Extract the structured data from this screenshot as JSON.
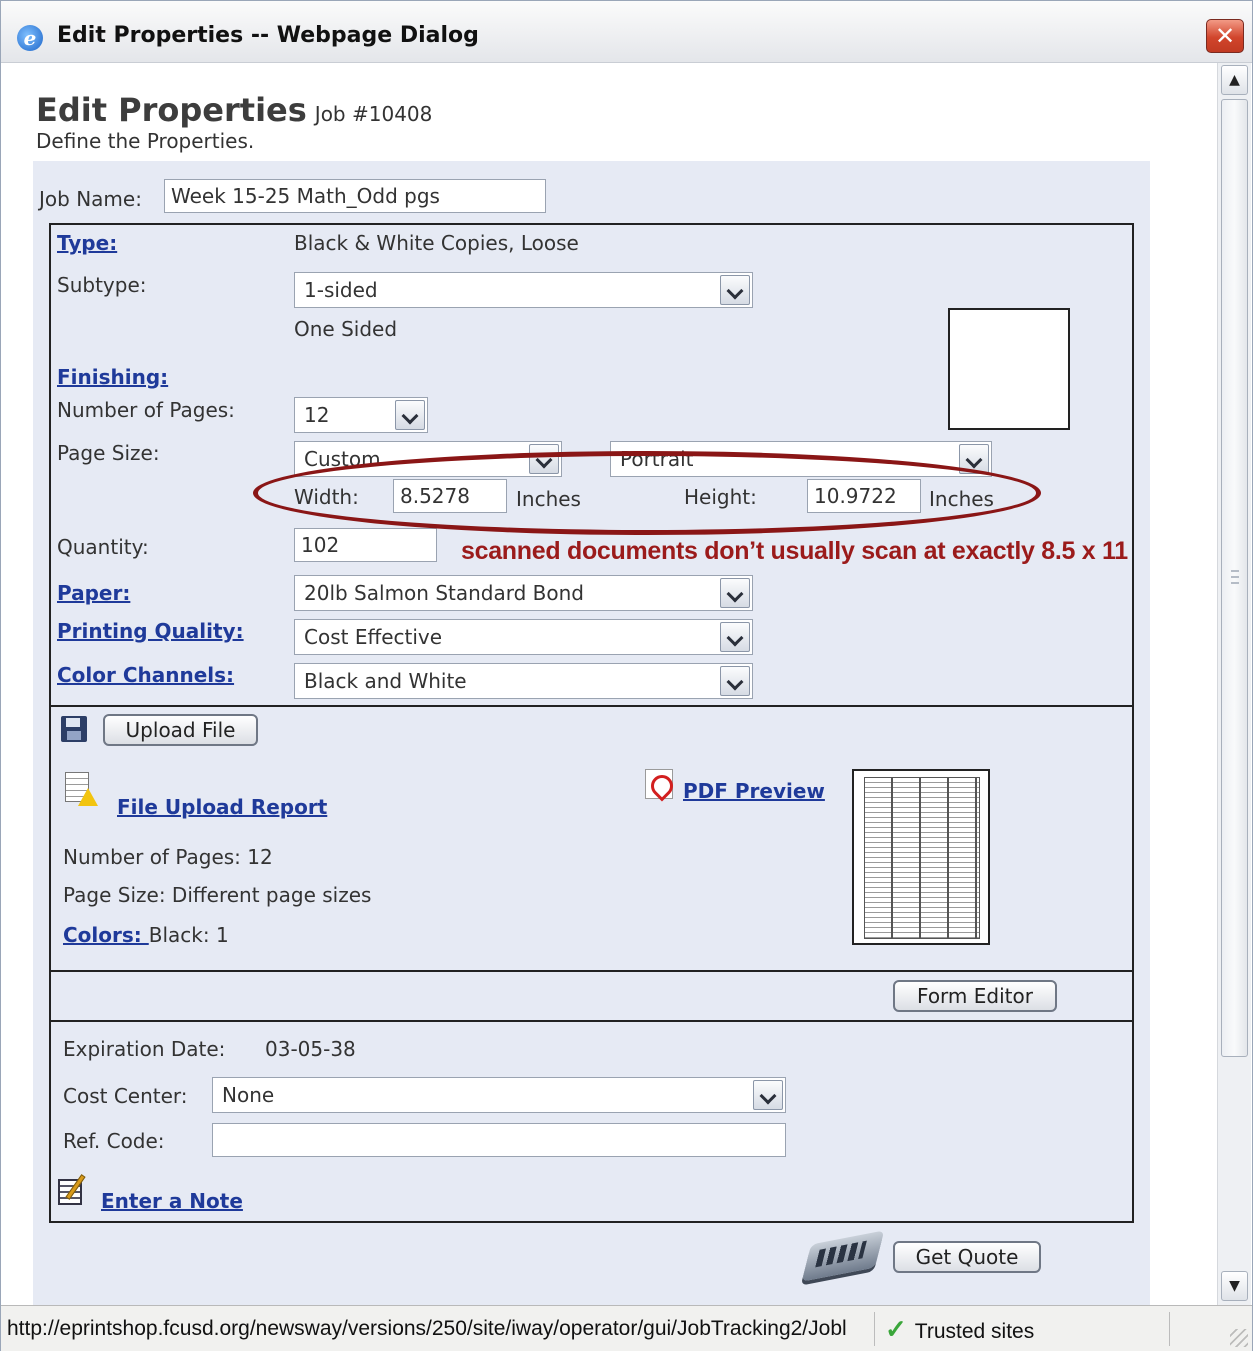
{
  "window": {
    "title": "Edit Properties -- Webpage Dialog",
    "close_symbol": "✕",
    "ie_symbol": "e"
  },
  "header": {
    "title": "Edit Properties",
    "job": "Job #10408",
    "subtitle": "Define the Properties."
  },
  "job_name": {
    "label": "Job Name:",
    "value": "Week 15-25 Math_Odd pgs"
  },
  "type": {
    "label": "Type:",
    "value": "Black & White Copies, Loose"
  },
  "subtype": {
    "label": "Subtype:",
    "value": "1-sided",
    "description": "One Sided"
  },
  "finishing": {
    "label": "Finishing:"
  },
  "pages": {
    "label": "Number of Pages:",
    "value": "12"
  },
  "page_size": {
    "label": "Page Size:",
    "size_value": "Custom",
    "orientation_value": "Portrait",
    "width_label": "Width:",
    "width_value": "8.5278",
    "width_unit": "Inches",
    "height_label": "Height:",
    "height_value": "10.9722",
    "height_unit": "Inches"
  },
  "quantity": {
    "label": "Quantity:",
    "value": "102"
  },
  "annotation": {
    "text": "scanned documents don’t usually scan at exactly 8.5 x 11",
    "color": "#9b1b1b"
  },
  "paper": {
    "label": "Paper:",
    "value": "20lb Salmon Standard Bond"
  },
  "printing_quality": {
    "label": "Printing Quality:",
    "value": "Cost Effective"
  },
  "color_channels": {
    "label": "Color Channels:",
    "value": "Black and White"
  },
  "upload": {
    "button_label": "Upload File",
    "report_link": "File Upload Report",
    "pdf_preview_link": "PDF Preview",
    "pages_text": "Number of Pages: 12",
    "page_size_text": "Page Size: Different page sizes",
    "colors_label": "Colors: ",
    "colors_value": "Black: 1"
  },
  "form_editor": {
    "button_label": "Form Editor"
  },
  "expiration": {
    "label": "Expiration Date:",
    "value": "03-05-38"
  },
  "cost_center": {
    "label": "Cost Center:",
    "value": "None"
  },
  "ref_code": {
    "label": "Ref. Code:",
    "value": ""
  },
  "note": {
    "link": "Enter a Note"
  },
  "quote": {
    "button_label": "Get Quote"
  },
  "scrollbar": {
    "up_symbol": "▲",
    "down_symbol": "▼"
  },
  "statusbar": {
    "url": "http://eprintshop.fcusd.org/newsway/versions/250/site/iway/operator/gui/JobTracking2/Jobl",
    "zone": "Trusted sites",
    "zone_symbol": "✓"
  },
  "colors": {
    "link": "#1f3a9a",
    "panel_background": "#e6eaf4",
    "close_button": "#d1452c"
  }
}
